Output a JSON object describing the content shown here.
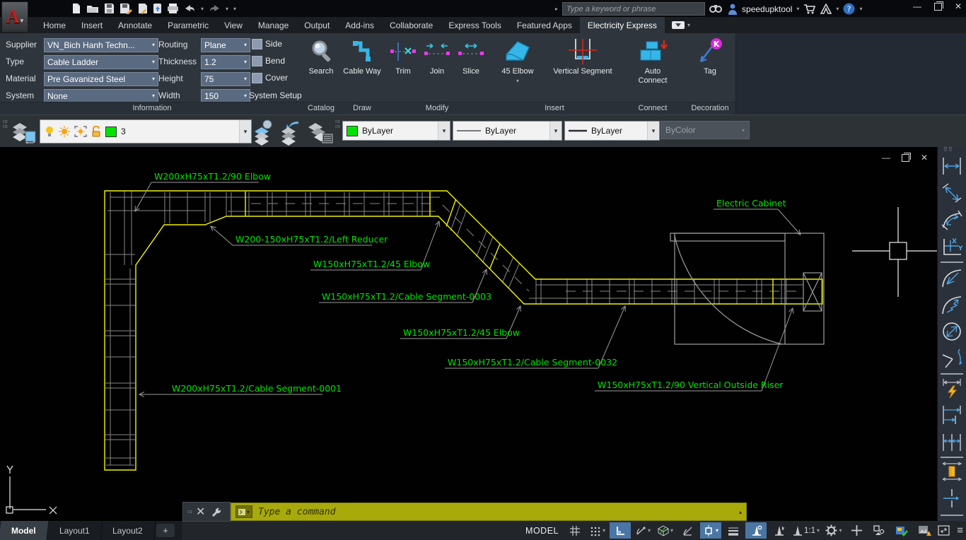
{
  "titlebar": {
    "search_placeholder": "Type a keyword or phrase",
    "username": "speedupktool",
    "help_glyph": "?"
  },
  "menubar": {
    "tabs": [
      "Home",
      "Insert",
      "Annotate",
      "Parametric",
      "View",
      "Manage",
      "Output",
      "Add-ins",
      "Collaborate",
      "Express Tools",
      "Featured Apps",
      "Electricity Express"
    ],
    "active_tab": "Electricity Express"
  },
  "ribbon": {
    "information": {
      "supplier_label": "Supplier",
      "supplier_value": "VN_Bich Hanh Techn...",
      "type_label": "Type",
      "type_value": "Cable Ladder",
      "material_label": "Material",
      "material_value": "Pre Gavanized Steel",
      "system_label": "System",
      "system_value": "None",
      "routing_label": "Routing",
      "routing_value": "Plane",
      "thickness_label": "Thickness",
      "thickness_value": "1.2",
      "height_label": "Height",
      "height_value": "75",
      "width_label": "Width",
      "width_value": "150",
      "check_side": "Side",
      "check_bend": "Bend",
      "check_cover": "Cover",
      "system_setup": "System Setup",
      "panel_label": "Information"
    },
    "buttons": {
      "search": "Search",
      "cable_way": "Cable Way",
      "trim": "Trim",
      "join": "Join",
      "slice": "Slice",
      "elbow45": "45 Elbow",
      "vertical_segment": "Vertical Segment",
      "auto_connect": "Auto Connect",
      "tag": "Tag"
    },
    "panel_labels": {
      "catalog": "Catalog",
      "draw": "Draw",
      "modify": "Modify",
      "insert": "Insert",
      "connect": "Connect",
      "decoration": "Decoration"
    }
  },
  "toolbars": {
    "layer_current": "3",
    "color_value": "ByLayer",
    "linetype_value": "ByLayer",
    "lineweight_value": "ByLayer",
    "plot_style_value": "ByColor"
  },
  "canvas": {
    "labels": [
      {
        "text": "W200xH75xT1.2/90 Elbow"
      },
      {
        "text": "W200-150xH75xT1.2/Left Reducer"
      },
      {
        "text": "W150xH75xT1.2/45 Elbow"
      },
      {
        "text": "W150xH75xT1.2/Cable Segment-0003"
      },
      {
        "text": "W150xH75xT1.2/45 Elbow"
      },
      {
        "text": "W150xH75xT1.2/Cable Segment-0032"
      },
      {
        "text": "W150xH75xT1.2/90 Vertical Outside Riser"
      },
      {
        "text": "W200xH75xT1.2/Cable Segment-0001"
      },
      {
        "text": "Electric Cabinet"
      }
    ],
    "ucs": {
      "x": "X",
      "y": "Y"
    }
  },
  "command": {
    "placeholder": "Type a command"
  },
  "statusbar": {
    "tabs": [
      "Model",
      "Layout1",
      "Layout2"
    ],
    "add_tab": "+",
    "model_space": "MODEL",
    "annotation_scale": "1:1"
  },
  "glyphs": {
    "caret_down": "▾",
    "caret_up": "▴",
    "triangle_right": "▸",
    "close": "✕",
    "minimize": "—",
    "hamburger": "≡",
    "plus": "+"
  },
  "colors": {
    "accent_cyan": "#35b6e8",
    "tray_yellow": "#f3f303",
    "label_green": "#00e400",
    "command_olive": "#a8a90b",
    "active_toggle": "#4a76a4",
    "layer_swatch": "#00e400",
    "magenta": "#e83ae8",
    "red": "#d42a1e"
  }
}
